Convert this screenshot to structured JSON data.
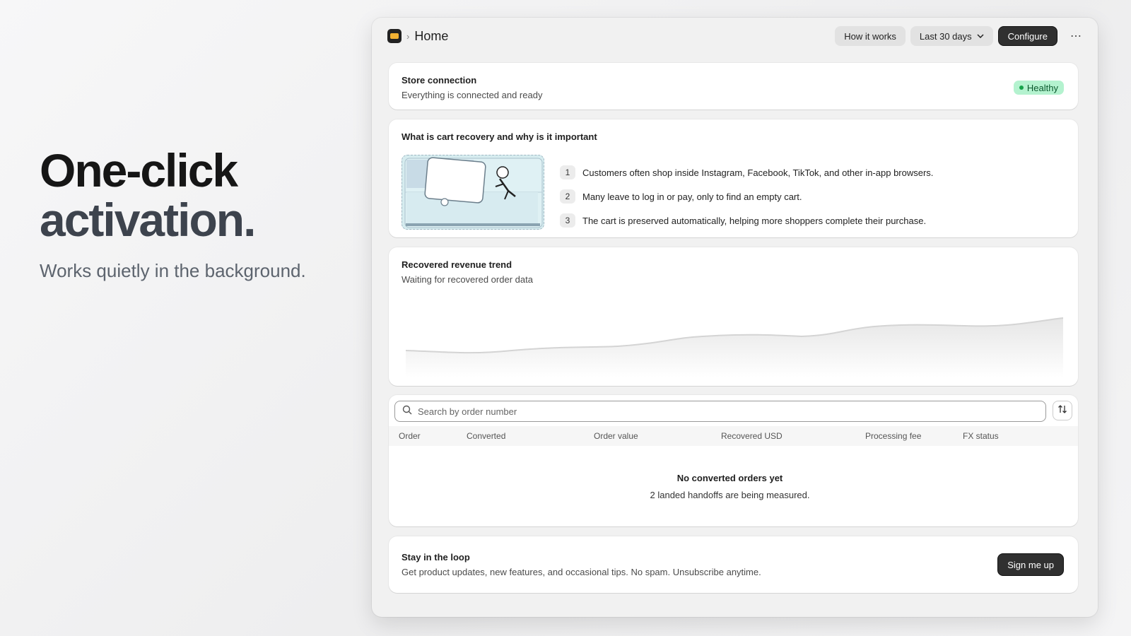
{
  "hero": {
    "line1": "One-click",
    "line2": "activation.",
    "subtitle": "Works quietly in the background."
  },
  "topbar": {
    "breadcrumb_separator": "›",
    "title": "Home",
    "how_it_works": "How it works",
    "date_range": "Last 30 days",
    "configure": "Configure",
    "more": "⋯"
  },
  "store_connection": {
    "title": "Store connection",
    "subtitle": "Everything is connected and ready",
    "status": "Healthy",
    "status_color": "#16a34a"
  },
  "cart_recovery": {
    "title": "What is cart recovery and why is it important",
    "steps": [
      {
        "num": "1",
        "text": "Customers often shop inside Instagram, Facebook, TikTok, and other in-app browsers."
      },
      {
        "num": "2",
        "text": "Many leave to log in or pay, only to find an empty cart."
      },
      {
        "num": "3",
        "text": "The cart is preserved automatically, helping more shoppers complete their purchase."
      }
    ]
  },
  "revenue_trend": {
    "title": "Recovered revenue trend",
    "subtitle": "Waiting for recovered order data"
  },
  "orders": {
    "search_placeholder": "Search by order number",
    "columns": [
      "Order",
      "Converted",
      "Order value",
      "Recovered USD",
      "Processing fee",
      "FX status"
    ],
    "empty_title": "No converted orders yet",
    "empty_subtitle": "2 landed handoffs are being measured."
  },
  "newsletter": {
    "title": "Stay in the loop",
    "subtitle": "Get product updates, new features, and occasional tips. No spam. Unsubscribe anytime.",
    "button": "Sign me up"
  }
}
